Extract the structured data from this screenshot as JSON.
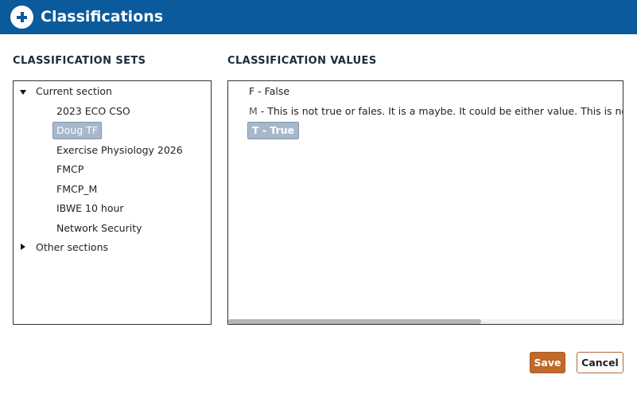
{
  "dialog": {
    "title": "Classifications",
    "icon": "plus-circle-icon",
    "header_color": "#0a5a9c"
  },
  "sets": {
    "label": "CLASSIFICATION SETS",
    "groups": [
      {
        "label": "Current section",
        "expanded": true,
        "items": [
          {
            "label": "2023 ECO CSO",
            "selected": false
          },
          {
            "label": "Doug TF",
            "selected": true
          },
          {
            "label": "Exercise Physiology 2026",
            "selected": false
          },
          {
            "label": "FMCP",
            "selected": false
          },
          {
            "label": "FMCP_M",
            "selected": false
          },
          {
            "label": "IBWE 10 hour",
            "selected": false
          },
          {
            "label": "Network Security",
            "selected": false
          }
        ]
      },
      {
        "label": "Other sections",
        "expanded": false,
        "items": []
      }
    ]
  },
  "values": {
    "label": "CLASSIFICATION VALUES",
    "items": [
      {
        "code": "F",
        "text": "F - False",
        "selected": false
      },
      {
        "code": "M",
        "text": " - This is not true or fales. It is a maybe. It could be either value. This is not true",
        "selected": false
      },
      {
        "code": "T",
        "text": "T - True",
        "selected": true
      }
    ]
  },
  "actions": {
    "save": "Save",
    "cancel": "Cancel",
    "save_color": "#c0692a"
  }
}
